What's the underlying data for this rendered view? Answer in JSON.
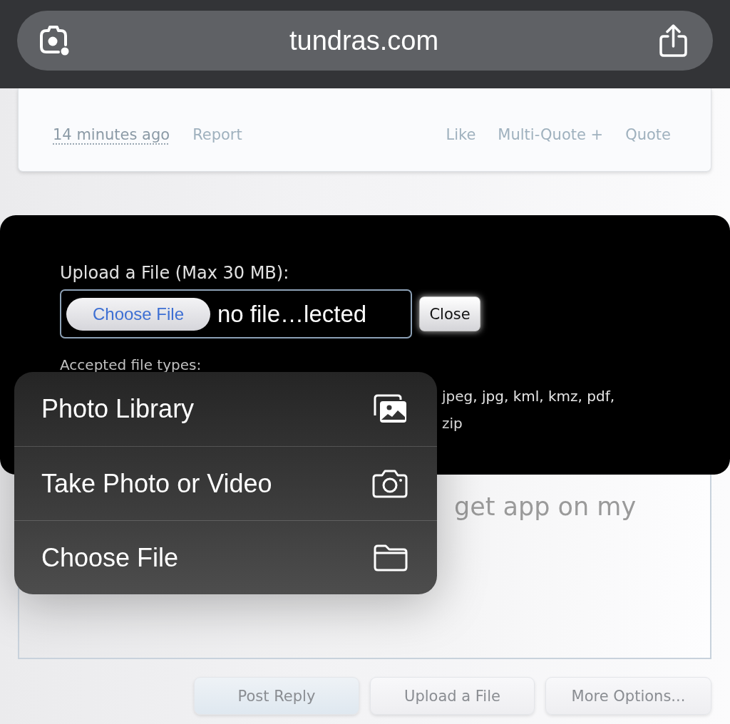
{
  "browser_bar": {
    "url": "tundras.com"
  },
  "post_footer": {
    "timestamp": "14 minutes ago",
    "left_links": [
      "Report"
    ],
    "right_links": [
      "Like",
      "Multi-Quote +",
      "Quote"
    ]
  },
  "upload_panel": {
    "title": "Upload a File (Max 30 MB):",
    "choose_button": "Choose File",
    "file_status": "no file…lected",
    "close_button": "Close",
    "accepted_label": "Accepted file types:",
    "accepted_types": [
      "jpeg, jpg, kml, kmz, pdf,",
      "zip"
    ]
  },
  "source_menu": {
    "items": [
      {
        "label": "Photo Library",
        "kind": "photos"
      },
      {
        "label": "Take Photo or Video",
        "kind": "camera"
      },
      {
        "label": "Choose File",
        "kind": "folder"
      }
    ]
  },
  "reply_box": {
    "text": "get app on my"
  },
  "buttons": [
    {
      "label": "Post Reply",
      "primary": true
    },
    {
      "label": "Upload a File",
      "primary": false
    },
    {
      "label": "More Options...",
      "primary": false
    }
  ]
}
